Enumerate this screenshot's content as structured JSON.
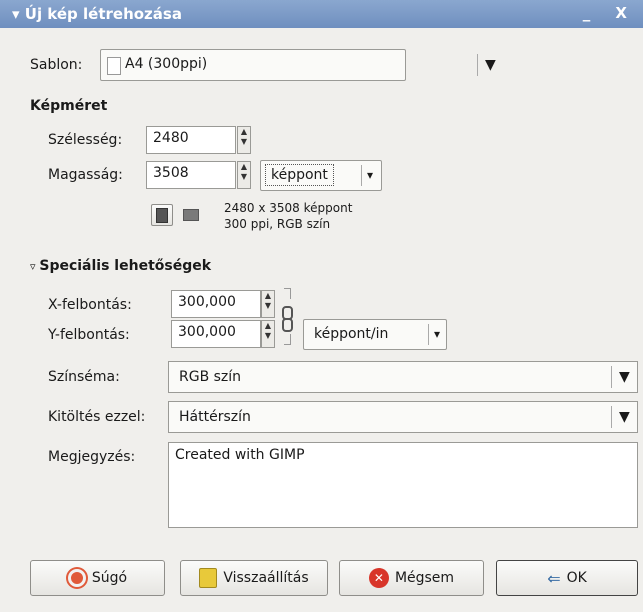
{
  "window": {
    "title": "Új kép létrehozása",
    "controls": "_ X"
  },
  "template": {
    "label": "Sablon:",
    "value": "A4 (300ppi)"
  },
  "image_size": {
    "heading": "Képméret",
    "width_label": "Szélesség:",
    "width_value": "2480",
    "height_label": "Magasság:",
    "height_value": "3508",
    "unit": "képpont",
    "info_line1": "2480 x 3508 képpont",
    "info_line2": "300 ppi, RGB szín"
  },
  "advanced": {
    "heading": "Speciális lehetőségek",
    "xres_label": "X-felbontás:",
    "xres_value": "300,000",
    "yres_label": "Y-felbontás:",
    "yres_value": "300,000",
    "res_unit": "képpont/in",
    "colorspace_label": "Színséma:",
    "colorspace_value": "RGB szín",
    "fill_label": "Kitöltés ezzel:",
    "fill_value": "Háttérszín",
    "comment_label": "Megjegyzés:",
    "comment_value": "Created with GIMP"
  },
  "buttons": {
    "help": "Súgó",
    "reset": "Visszaállítás",
    "cancel": "Mégsem",
    "ok": "OK"
  },
  "colors": {
    "titlebar": "#7896c6",
    "cancel_icon": "#d8352a",
    "help_icon": "#e05a3a"
  }
}
